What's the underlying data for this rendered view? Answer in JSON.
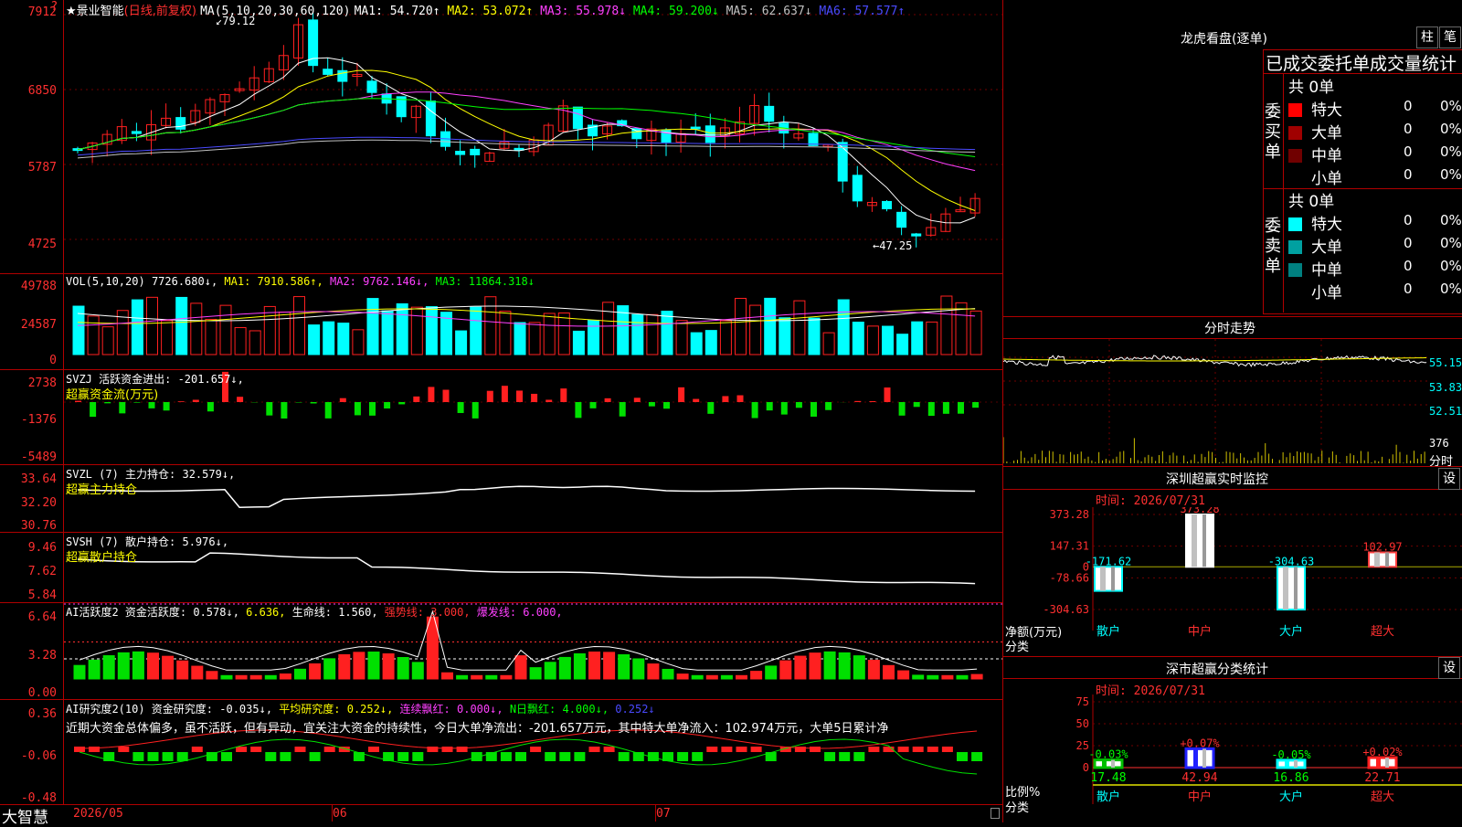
{
  "stock": {
    "title": "★景业智能",
    "mode": "(日线,前复权)",
    "ma_header": "MA(5,10,20,30,60,120)",
    "ma_values": [
      {
        "label": "MA1: 54.720↑",
        "color": "#ffffff"
      },
      {
        "label": "MA2: 53.072↑",
        "color": "#ffff00"
      },
      {
        "label": "MA3: 55.978↓",
        "color": "#ff40ff"
      },
      {
        "label": "MA4: 59.200↓",
        "color": "#00ff00"
      },
      {
        "label": "MA5: 62.637↓",
        "color": "#c0c0c0"
      },
      {
        "label": "MA6: 57.577↑",
        "color": "#4a4aff"
      }
    ],
    "high_marker": "79.12",
    "low_marker": "←47.25",
    "price_axis": [
      "7912",
      "6850",
      "5787",
      "4725"
    ]
  },
  "volume": {
    "header": "VOL(5,10,20)",
    "values": [
      {
        "label": "7726.680↓,",
        "color": "#ffffff"
      },
      {
        "label": "MA1: 7910.586↑,",
        "color": "#ffff00"
      },
      {
        "label": "MA2: 9762.146↓,",
        "color": "#ff40ff"
      },
      {
        "label": "MA3: 11864.318↓",
        "color": "#00ff00"
      }
    ],
    "axis": [
      "49788",
      "24587",
      "0"
    ]
  },
  "svzj": {
    "header": "SVZJ  活跃资金进出: -201.657↓,",
    "subtitle": "超赢资金流(万元)",
    "axis": [
      "2738",
      "-1376",
      "-5489"
    ]
  },
  "svzl": {
    "header": "SVZL (7) 主力持仓: 32.579↓,",
    "subtitle": "超赢主力持仓",
    "axis": [
      "33.64",
      "32.20",
      "30.76"
    ]
  },
  "svsh": {
    "header": "SVSH (7) 散户持仓: 5.976↓,",
    "subtitle": "超赢散户持仓",
    "axis": [
      "9.46",
      "7.62",
      "5.84"
    ]
  },
  "ai_active": {
    "header": "AI活跃度2 资金活跃度: 0.578↓,",
    "v2": "6.636,",
    "v3": "生命线: 1.560,",
    "v4": "强势线: 3.000,",
    "v5": "爆发线: 6.000,",
    "axis": [
      "6.64",
      "3.28",
      "0.00"
    ]
  },
  "ai_research": {
    "header": "AI研究度2(10) 资金研究度: -0.035↓,",
    "v2": "平均研究度: 0.252↓,",
    "v3": "连续飘红: 0.000↓,",
    "v4": "N日飘红: 4.000↓,",
    "v5": "0.252↓",
    "commentary": "近期大资金总体偏多，虽不活跃，但有异动，宜关注大资金的持续性，今日大单净流出：-201.657万元，其中特大单净流入：102.974万元，大单5日累计净",
    "axis": [
      "0.36",
      "-0.06",
      "-0.48"
    ]
  },
  "xaxis": {
    "labels": [
      "2026/05",
      "06",
      "07"
    ]
  },
  "brand": "大智慧",
  "longhu": {
    "title": "龙虎看盘(逐单)",
    "btn1": "柱",
    "btn2": "笔",
    "header": "已成交委托单成交量统计",
    "buy_label": "委买单",
    "sell_label": "委卖单",
    "buy_total": "共 0单",
    "sell_total": "共 0单",
    "buy_rows": [
      {
        "name": "特大",
        "count": "0",
        "pct": "0%",
        "color": "#ff0000"
      },
      {
        "name": "大单",
        "count": "0",
        "pct": "0%",
        "color": "#a00000"
      },
      {
        "name": "中单",
        "count": "0",
        "pct": "0%",
        "color": "#700000"
      },
      {
        "name": "小单",
        "count": "0",
        "pct": "0%",
        "color": "#000000"
      }
    ],
    "sell_rows": [
      {
        "name": "特大",
        "count": "0",
        "pct": "0%",
        "color": "#00ffff"
      },
      {
        "name": "大单",
        "count": "0",
        "pct": "0%",
        "color": "#00a0a0"
      },
      {
        "name": "中单",
        "count": "0",
        "pct": "0%",
        "color": "#008080"
      },
      {
        "name": "小单",
        "count": "0",
        "pct": "0%",
        "color": "#000000"
      }
    ]
  },
  "intraday": {
    "title": "分时走势",
    "axis": [
      "55.15",
      "53.83",
      "52.51"
    ],
    "vol_axis": "376",
    "vol_label": "分时"
  },
  "sz_monitor": {
    "title": "深圳超赢实时监控",
    "btn": "设",
    "time": "时间: 2026/07/31",
    "axis": [
      "373.28",
      "147.31",
      "0",
      "-78.66",
      "-304.63"
    ],
    "ylabel1": "净额(万元)",
    "ylabel2": "分类",
    "categories": [
      "散户",
      "中户",
      "大户",
      "超大"
    ],
    "values": [
      -171.62,
      373.28,
      -304.63,
      102.97
    ],
    "value_labels": [
      "-171.62",
      "373.28",
      "-304.63",
      "102.97"
    ]
  },
  "sz_class": {
    "title": "深市超赢分类统计",
    "btn": "设",
    "time": "时间: 2026/07/31",
    "axis": [
      "75",
      "50",
      "25",
      "0"
    ],
    "ylabel1": "比例%",
    "ylabel2": "分类",
    "categories": [
      "散户",
      "中户",
      "大户",
      "超大"
    ],
    "values": [
      17.48,
      42.94,
      16.86,
      22.71
    ],
    "value_labels": [
      "17.48",
      "42.94",
      "16.86",
      "22.71"
    ],
    "change_labels": [
      "-0.03%",
      "+0.07%",
      "-0.05%",
      "+0.02%"
    ]
  },
  "chart_data": [
    {
      "type": "candlestick",
      "title": "★景业智能(日线,前复权)",
      "ylim": [
        47.25,
        79.12
      ],
      "x_labels": [
        "2026/05",
        "06",
        "07"
      ],
      "annotations": [
        "79.12",
        "47.25"
      ]
    },
    {
      "type": "bar",
      "title": "深圳超赢实时监控",
      "categories": [
        "散户",
        "中户",
        "大户",
        "超大"
      ],
      "values": [
        -171.62,
        373.28,
        -304.63,
        102.97
      ],
      "ylabel": "净额(万元)"
    },
    {
      "type": "bar",
      "title": "深市超赢分类统计",
      "categories": [
        "散户",
        "中户",
        "大户",
        "超大"
      ],
      "values": [
        17.48,
        42.94,
        16.86,
        22.71
      ],
      "ylabel": "比例%",
      "ylim": [
        0,
        75
      ]
    }
  ],
  "colors": {
    "up": "#ff2020",
    "down": "#00ffff",
    "frame": "#b00000"
  }
}
